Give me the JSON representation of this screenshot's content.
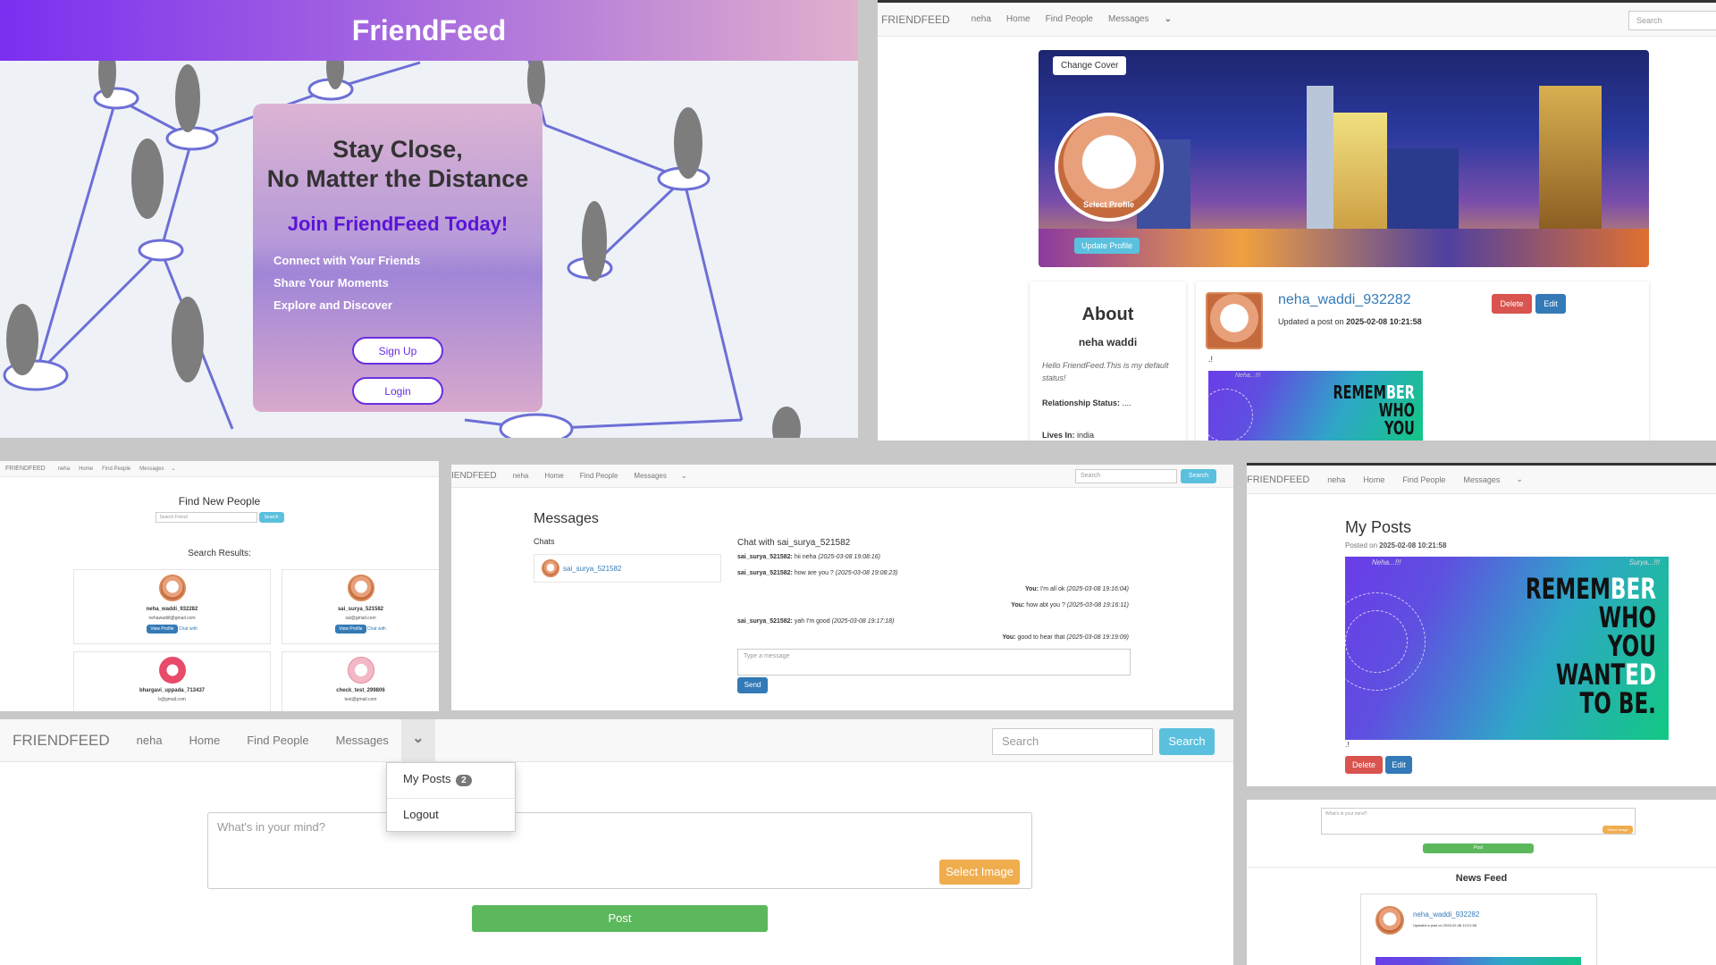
{
  "landing": {
    "title": "FriendFeed",
    "headline1": "Stay Close,",
    "headline2": "No Matter the Distance",
    "join": "Join FriendFeed Today!",
    "features": [
      "Connect with Your Friends",
      "Share Your Moments",
      "Explore and Discover"
    ],
    "signup": "Sign Up",
    "login": "Login"
  },
  "nav": {
    "brand": "FRIENDFEED",
    "brand_cropped": "IENDFEED",
    "user": "neha",
    "home": "Home",
    "find": "Find People",
    "messages": "Messages",
    "search_placeholder": "Search",
    "search_button": "Search"
  },
  "profile": {
    "change_cover": "Change Cover",
    "select_profile": "Select Profile",
    "update_profile": "Update Profile",
    "about_title": "About",
    "name": "neha waddi",
    "status": "Hello FriendFeed.This is my default status!",
    "relationship_label": "Relationship Status:",
    "relationship_value": "....",
    "lives_label": "Lives In:",
    "lives_value": "india",
    "post_user": "neha_waddi_932282",
    "post_meta_prefix": "Updated a post on",
    "post_date": "2025-02-08 10:21:58",
    "post_text": ".!",
    "delete": "Delete",
    "edit": "Edit"
  },
  "poster": {
    "tag1": "Neha...!!!",
    "tag2": "Surya...!!!",
    "line1a": "REMEM",
    "line1b": "BER",
    "line2": "WHO",
    "line3": "YOU",
    "line4a": "WANT",
    "line4b": "ED",
    "line5": "TO BE."
  },
  "find": {
    "title": "Find New People",
    "placeholder": "Search Friend",
    "search": "Search",
    "results_title": "Search Results:",
    "view_profile": "View Profile",
    "chat_with": "Chat with",
    "people": [
      {
        "name": "neha_waddi_932282",
        "email": "nehawaddi@gmail.com"
      },
      {
        "name": "sai_surya_521582",
        "email": "sai@gmail.com"
      },
      {
        "name": "bhargavi_uppada_713437",
        "email": "b@gmail.com"
      },
      {
        "name": "check_test_299806",
        "email": "test@gmail.com"
      }
    ]
  },
  "messages": {
    "title": "Messages",
    "chats_label": "Chats",
    "chat_contact": "sai_surya_521582",
    "chat_with": "Chat with sai_surya_521582",
    "lines": [
      {
        "from": "sai_surya_521582:",
        "text": "hii neha",
        "time": "(2025-03-08 19:08:16)",
        "side": "left"
      },
      {
        "from": "sai_surya_521582:",
        "text": "how are you ?",
        "time": "(2025-03-08 19:08:23)",
        "side": "left"
      },
      {
        "from": "You:",
        "text": "I'm all ok",
        "time": "(2025-03-08 19:16:04)",
        "side": "right"
      },
      {
        "from": "You:",
        "text": "how abt you ?",
        "time": "(2025-03-08 19:16:11)",
        "side": "right"
      },
      {
        "from": "sai_surya_521582:",
        "text": "yah I'm good",
        "time": "(2025-03-08 19:17:18)",
        "side": "left"
      },
      {
        "from": "You:",
        "text": "good to hear that",
        "time": "(2025-03-08 19:19:09)",
        "side": "right"
      }
    ],
    "placeholder": "Type a message",
    "send": "Send"
  },
  "myposts": {
    "title": "My Posts",
    "posted_prefix": "Posted on",
    "date": "2025-02-08 10:21:58",
    "text": ".!",
    "delete": "Delete",
    "edit": "Edit"
  },
  "home": {
    "dropdown_myposts": "My Posts",
    "dropdown_count": "2",
    "dropdown_logout": "Logout",
    "placeholder": "What's in your mind?",
    "select_image": "Select Image",
    "post": "Post"
  },
  "feed": {
    "placeholder": "What's in your mind?",
    "select_image": "Select Image",
    "post": "Post",
    "title": "News Feed",
    "post_user": "neha_waddi_932282",
    "post_meta": "Updated a post on 2025-02-08 10:21:58"
  },
  "colors": {
    "brand_purple": "#7a2ff0",
    "primary": "#337ab7",
    "danger": "#d9534f",
    "info": "#5bc0de",
    "success": "#5cb85c",
    "warning": "#f0ad4e"
  }
}
